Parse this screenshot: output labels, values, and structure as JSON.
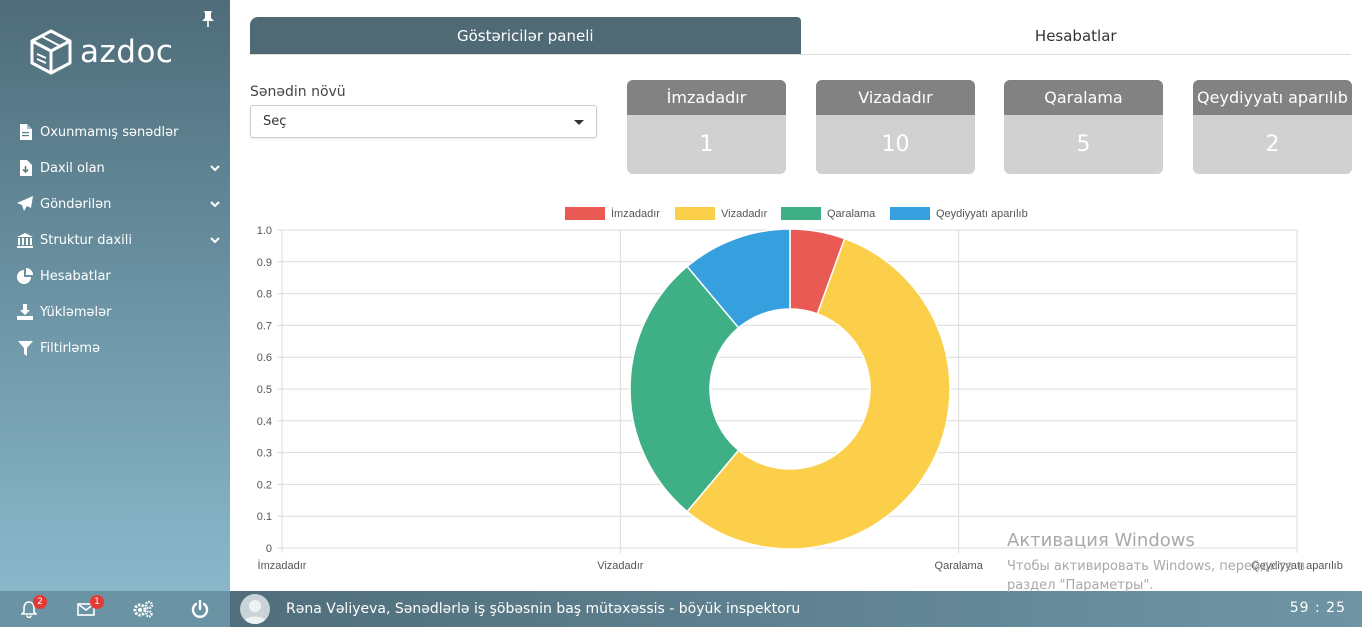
{
  "app": {
    "logo_text": "azdoc"
  },
  "sidebar": {
    "items": [
      {
        "label": "Oxunmamış sənədlər",
        "icon": "document-icon",
        "has_submenu": false
      },
      {
        "label": "Daxil olan",
        "icon": "inbox-download-icon",
        "has_submenu": true
      },
      {
        "label": "Göndərilən",
        "icon": "paper-plane-icon",
        "has_submenu": true
      },
      {
        "label": "Struktur daxili",
        "icon": "institution-icon",
        "has_submenu": true
      },
      {
        "label": "Hesabatlar",
        "icon": "pie-chart-icon",
        "has_submenu": false
      },
      {
        "label": "Yükləmələr",
        "icon": "download-icon",
        "has_submenu": false
      },
      {
        "label": "Filtirləmə",
        "icon": "filter-icon",
        "has_submenu": false
      }
    ]
  },
  "footer": {
    "notifications_count": "2",
    "messages_count": "1",
    "user_text": "Rəna Vəliyeva, Sənədlərlə iş şöbəsnin baş mütəxəssis - böyük inspektoru",
    "clock": "59 : 25"
  },
  "tabs": [
    {
      "label": "Göstəricilər paneli",
      "active": true
    },
    {
      "label": "Hesabatlar",
      "active": false
    }
  ],
  "filter": {
    "label": "Sənədin növü",
    "selected": "Seç"
  },
  "stats": [
    {
      "title": "İmzadadır",
      "value": "1"
    },
    {
      "title": "Vizadadır",
      "value": "10"
    },
    {
      "title": "Qaralama",
      "value": "5"
    },
    {
      "title": "Qeydiyyatı aparılıb",
      "value": "2"
    }
  ],
  "chart_data": {
    "type": "pie",
    "variant": "doughnut",
    "categories": [
      "İmzadadır",
      "Vizadadır",
      "Qaralama",
      "Qeydiyyatı aparılıb"
    ],
    "values": [
      1,
      10,
      5,
      2
    ],
    "colors": [
      "#ea5a55",
      "#fbcf4a",
      "#3fb085",
      "#369fde"
    ],
    "legend": "top",
    "y_ticks": [
      "1.0",
      "0.9",
      "0.8",
      "0.7",
      "0.6",
      "0.5",
      "0.4",
      "0.3",
      "0.2",
      "0.1",
      "0"
    ],
    "x_ticks": [
      "İmzadadır",
      "Vizadadır",
      "Qaralama",
      "Qeydiyyatı aparılıb"
    ],
    "ylim": [
      0,
      1
    ],
    "grid": true
  },
  "watermark": {
    "title": "Активация Windows",
    "line1": "Чтобы активировать Windows, перейдите в",
    "line2": "раздел \"Параметры\"."
  }
}
